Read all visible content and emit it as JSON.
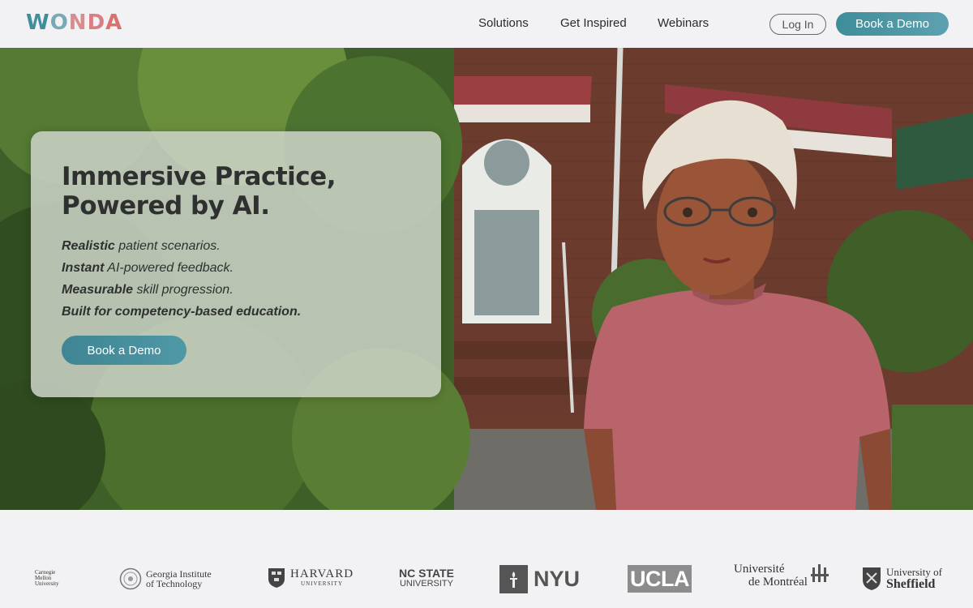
{
  "header": {
    "logo_letters": [
      "W",
      "O",
      "N",
      "D",
      "A"
    ],
    "logo_colors": [
      "#3f8e9c",
      "#78a9b6",
      "#d98b8e",
      "#d97f84",
      "#d9726e"
    ],
    "nav": [
      "Solutions",
      "Get Inspired",
      "Webinars"
    ],
    "login_label": "Log In",
    "demo_label": "Book a Demo",
    "accent": "#4b94a3"
  },
  "hero": {
    "title_lines": [
      "Immersive Practice,",
      "Powered by AI."
    ],
    "bullets": [
      {
        "strong": "Realistic",
        "rest": " patient scenarios."
      },
      {
        "strong": "Instant",
        "rest": " AI-powered feedback."
      },
      {
        "strong": "Measurable",
        "rest": " skill progression."
      },
      {
        "strong": "Built for competency-based education.",
        "rest": ""
      }
    ],
    "cta_label": "Book a Demo",
    "image_description_icons": [
      "brick-house-illustration",
      "avatar-character"
    ]
  },
  "logos": {
    "cmu": [
      "Carnegie",
      "Mellon",
      "University"
    ],
    "gatech": [
      "Georgia Institute",
      "of Technology"
    ],
    "harvard": [
      "HARVARD",
      "UNIVERSITY"
    ],
    "ncstate": [
      "NC STATE",
      "UNIVERSITY"
    ],
    "nyu": "NYU",
    "ucla": "UCLA",
    "montreal": [
      "Université",
      "de Montréal"
    ],
    "sheffield": [
      "University of",
      "Sheffield"
    ]
  }
}
